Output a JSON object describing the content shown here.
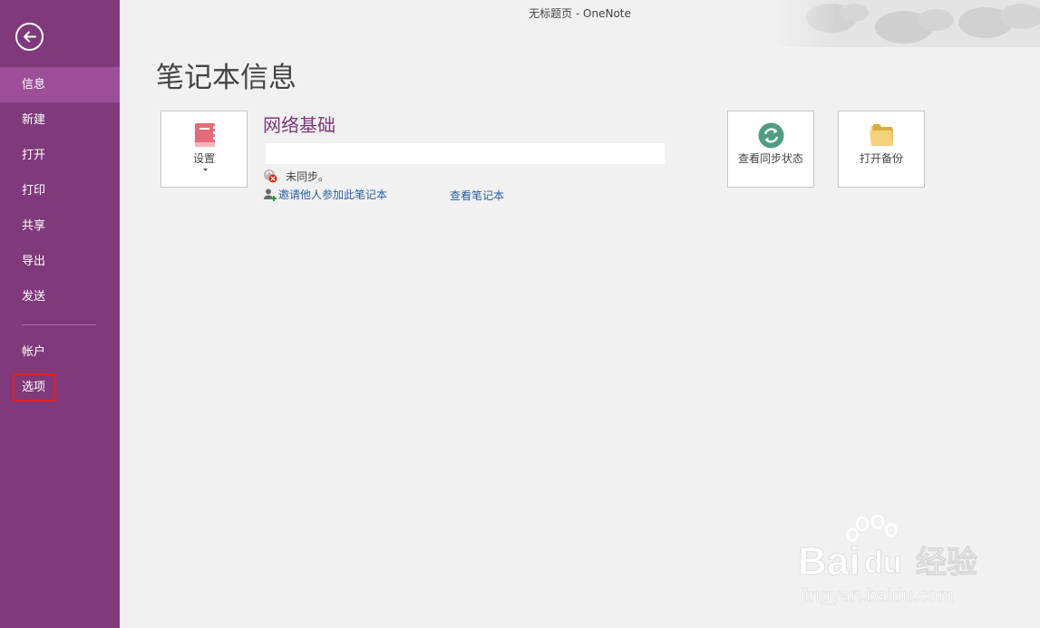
{
  "window": {
    "title": "无标题页 - OneNote"
  },
  "sidebar": {
    "items": [
      {
        "label": "信息"
      },
      {
        "label": "新建"
      },
      {
        "label": "打开"
      },
      {
        "label": "打印"
      },
      {
        "label": "共享"
      },
      {
        "label": "导出"
      },
      {
        "label": "发送"
      },
      {
        "label": "帐户"
      },
      {
        "label": "选项"
      }
    ]
  },
  "main": {
    "page_title": "笔记本信息",
    "settings_tile": {
      "label": "设置"
    },
    "notebook_name": "网络基础",
    "sync_status": "未同步。",
    "invite_link": "邀请他人参加此笔记本",
    "view_link": "查看笔记本",
    "view_sync_tile": {
      "label": "查看同步状态"
    },
    "open_backup_tile": {
      "label": "打开备份"
    }
  },
  "watermark": {
    "brand": "Bai",
    "brand2": "du",
    "cn": "经验",
    "url": "jingyan.baidu.com"
  },
  "colors": {
    "sidebar": "#80397b",
    "sidebar_active": "#9b4f96",
    "accent": "#80397b",
    "link": "#2a5fa5",
    "highlight": "#e0201f"
  }
}
